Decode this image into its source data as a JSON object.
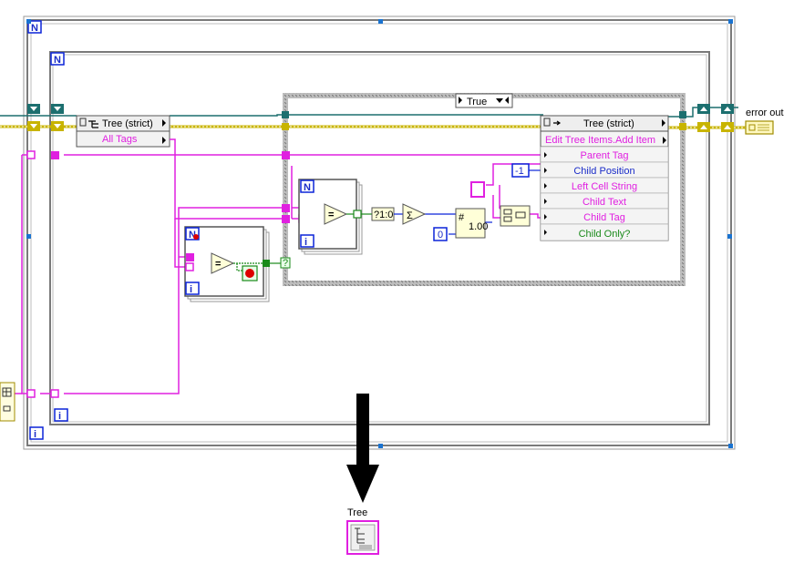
{
  "case_structure": {
    "selector": "True"
  },
  "tree_left": {
    "title": "Tree (strict)",
    "property": "All Tags"
  },
  "tree_right": {
    "title": "Tree (strict)",
    "method": "Edit Tree Items.Add Item",
    "params": [
      "Parent Tag",
      "Child Position",
      "Left Cell String",
      "Child Text",
      "Child Tag",
      "Child Only?"
    ]
  },
  "loops": {
    "count": "N",
    "index": "i"
  },
  "constants": {
    "child_position": "-1",
    "zero": "0",
    "empty_string": "",
    "question": "?"
  },
  "functions": {
    "to_bool": "?1:0",
    "sum": "Σ"
  },
  "outputs": {
    "error_out": "error out"
  },
  "terminals": {
    "tree": "Tree"
  },
  "colors": {
    "string_wire": "#e020e0",
    "refnum_wire": "#1c6f6f",
    "error_wire": "#c8b400",
    "numeric_wire": "#0b24d9",
    "bool_wire": "#1a8a1a",
    "error_cluster": "#c8b400"
  },
  "icons": [
    "tree-refnum-icon",
    "stop-button-icon",
    "down-arrow-icon",
    "tree-terminal-icon",
    "error-cluster-icon",
    "array-icon"
  ]
}
